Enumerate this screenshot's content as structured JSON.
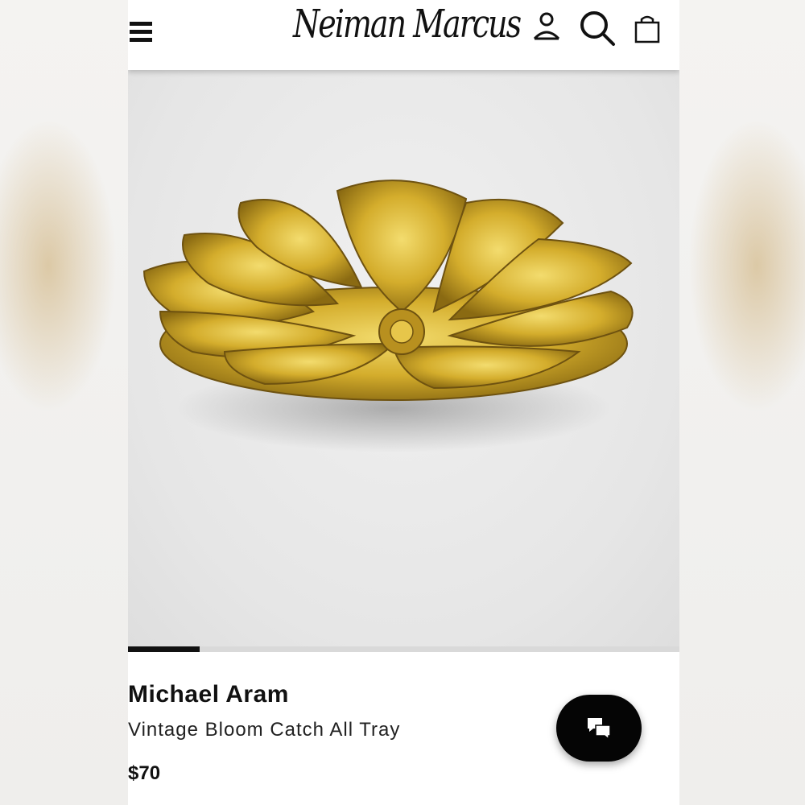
{
  "header": {
    "logo_text": "Neiman Marcus",
    "icons": [
      "menu-icon",
      "account-icon",
      "search-icon",
      "shopping-bag-icon"
    ]
  },
  "gallery": {
    "image_description": "gold flower-shaped catch all tray",
    "progress": 0.13
  },
  "product": {
    "brand": "Michael Aram",
    "name": "Vintage Bloom Catch All Tray",
    "price": "$70"
  },
  "chat": {
    "icon": "chat-bubbles-icon"
  },
  "colors": {
    "accent": "#111111",
    "gold": "#c9a227",
    "background": "#ffffff"
  }
}
